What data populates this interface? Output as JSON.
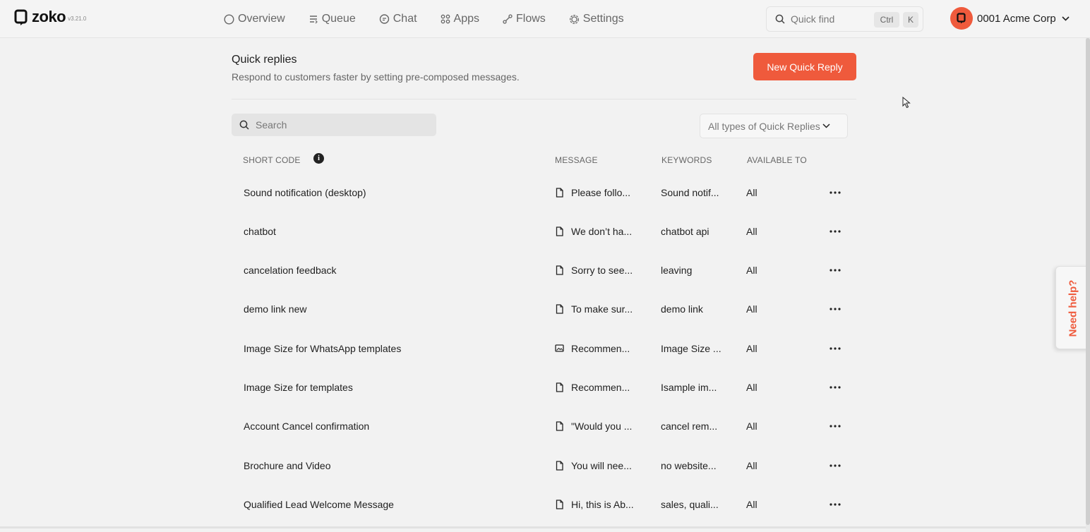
{
  "app": {
    "name": "zoko",
    "version": "v3.21.0",
    "accent": "#ef5a3c"
  },
  "nav": [
    {
      "label": "Overview",
      "icon": "circle-icon"
    },
    {
      "label": "Queue",
      "icon": "queue-icon"
    },
    {
      "label": "Chat",
      "icon": "chat-bubble-icon"
    },
    {
      "label": "Apps",
      "icon": "apps-grid-icon"
    },
    {
      "label": "Flows",
      "icon": "flows-icon"
    },
    {
      "label": "Settings",
      "icon": "gear-icon"
    }
  ],
  "quickfind": {
    "label": "Quick find",
    "key1": "Ctrl",
    "key2": "K"
  },
  "org": {
    "name": "0001 Acme Corp"
  },
  "page": {
    "title": "Quick replies",
    "subtitle": "Respond to customers faster by setting pre-composed messages.",
    "new_button": "New Quick Reply"
  },
  "search": {
    "placeholder": "Search"
  },
  "filter": {
    "selected": "All types of Quick Replies"
  },
  "table": {
    "headers": {
      "code": "SHORT CODE",
      "message": "MESSAGE",
      "keywords": "KEYWORDS",
      "available": "AVAILABLE TO"
    },
    "rows": [
      {
        "code": "Sound notification (desktop)",
        "message_type": "document-icon",
        "message": "Please follo...",
        "keywords": "Sound notif...",
        "available": "All"
      },
      {
        "code": "chatbot",
        "message_type": "document-icon",
        "message": "We don’t ha...",
        "keywords": "chatbot api",
        "available": "All"
      },
      {
        "code": "cancelation feedback",
        "message_type": "document-icon",
        "message": "Sorry to see...",
        "keywords": "leaving",
        "available": "All"
      },
      {
        "code": "demo link new",
        "message_type": "document-icon",
        "message": "To make sur...",
        "keywords": "demo link",
        "available": "All"
      },
      {
        "code": "Image Size for WhatsApp templates",
        "message_type": "image-icon",
        "message": "Recommen...",
        "keywords": "Image Size ...",
        "available": "All"
      },
      {
        "code": "Image Size for templates",
        "message_type": "document-icon",
        "message": "Recommen...",
        "keywords": "Isample im...",
        "available": "All"
      },
      {
        "code": "Account Cancel confirmation",
        "message_type": "document-icon",
        "message": "\"Would you ...",
        "keywords": "cancel rem...",
        "available": "All"
      },
      {
        "code": "Brochure and Video",
        "message_type": "document-icon",
        "message": "You will nee...",
        "keywords": "no website...",
        "available": "All"
      },
      {
        "code": "Qualified Lead Welcome Message",
        "message_type": "document-icon",
        "message": "Hi, this is Ab...",
        "keywords": "sales, quali...",
        "available": "All"
      }
    ]
  },
  "help": {
    "label": "Need help?"
  }
}
